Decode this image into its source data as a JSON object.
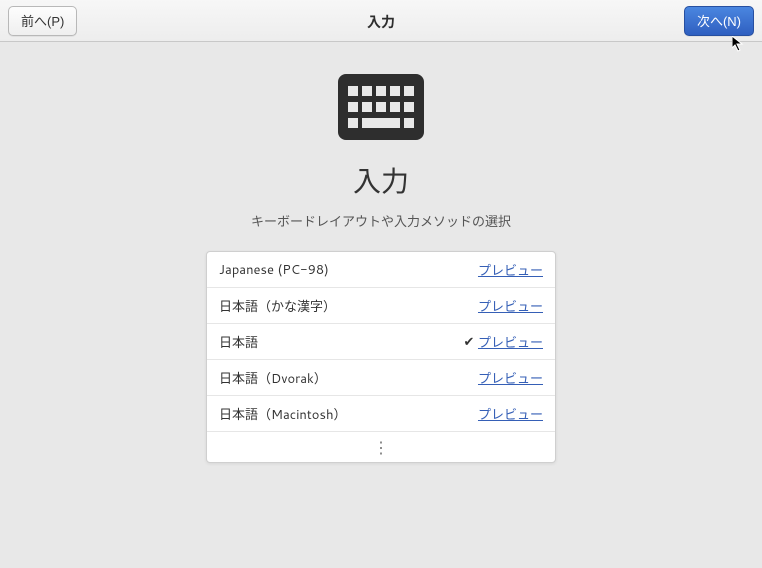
{
  "header": {
    "back_label": "前へ(P)",
    "title": "入力",
    "next_label": "次へ(N)"
  },
  "page": {
    "title": "入力",
    "subtitle": "キーボードレイアウトや入力メソッドの選択"
  },
  "preview_label": "プレビュー",
  "layouts": [
    {
      "name": "Japanese (PC-98)",
      "selected": false
    },
    {
      "name": "日本語（かな漢字）",
      "selected": false
    },
    {
      "name": "日本語",
      "selected": true
    },
    {
      "name": "日本語（Dvorak）",
      "selected": false
    },
    {
      "name": "日本語（Macintosh）",
      "selected": false
    }
  ]
}
